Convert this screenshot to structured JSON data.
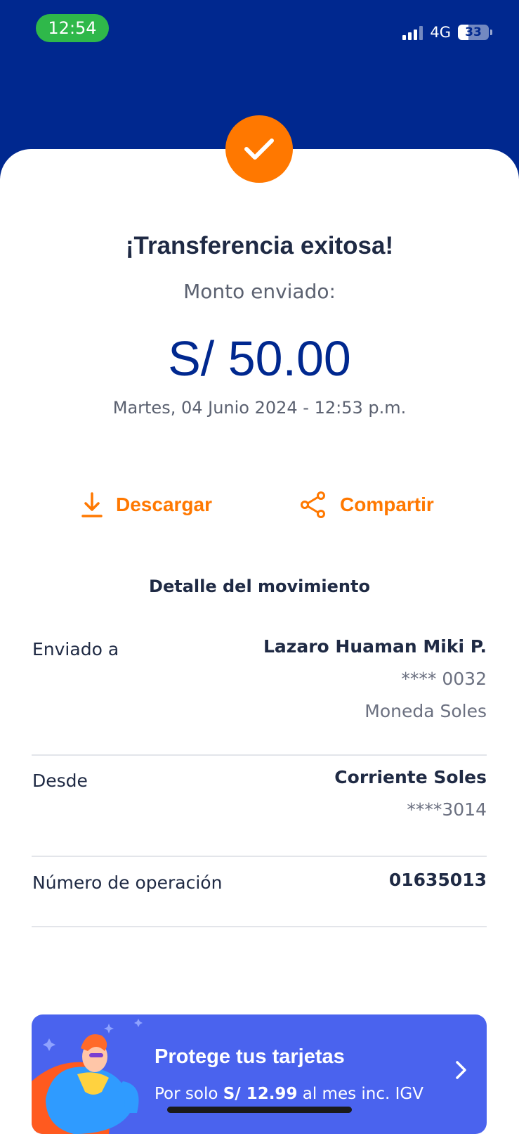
{
  "status_bar": {
    "time": "12:54",
    "network": "4G",
    "battery": "33"
  },
  "result": {
    "title": "¡Transferencia exitosa!",
    "subtitle": "Monto enviado:",
    "amount": "S/ 50.00",
    "datetime": "Martes, 04 Junio 2024 - 12:53 p.m."
  },
  "actions": {
    "download_label": "Descargar",
    "share_label": "Compartir"
  },
  "detail": {
    "section_title": "Detalle del movimiento",
    "rows": [
      {
        "label": "Enviado a",
        "values": [
          "Lazaro Huaman Miki P.",
          "**** 0032",
          "Moneda Soles"
        ]
      },
      {
        "label": "Desde",
        "values": [
          "Corriente Soles",
          "****3014"
        ]
      },
      {
        "label": "Número de operación",
        "values": [
          "01635013"
        ]
      }
    ]
  },
  "banner": {
    "title": "Protege tus tarjetas",
    "sub_prefix": "Por solo",
    "sub_price": "S/ 12.99",
    "sub_suffix": "al mes inc. IGV"
  },
  "colors": {
    "header_blue": "#00288f",
    "accent_orange": "#ff7800",
    "banner_blue": "#4a63ee",
    "status_green": "#2fb84a"
  },
  "icons": [
    "check-icon",
    "download-icon",
    "share-icon",
    "chevron-right-icon",
    "signal-icon",
    "battery-icon"
  ]
}
